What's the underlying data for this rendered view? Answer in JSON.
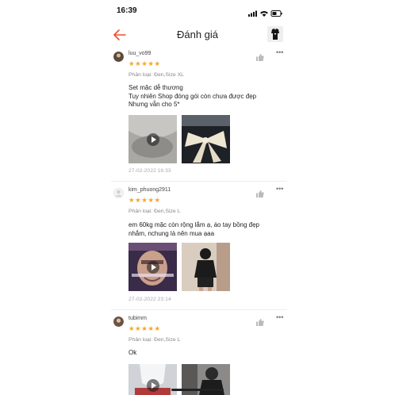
{
  "status_bar": {
    "time": "16:39"
  },
  "header": {
    "title": "Đánh giá"
  },
  "reviews": [
    {
      "username": "luu_vo99",
      "stars": "★★★★★",
      "variant": "Phân loại: Đen,Size XL",
      "text": [
        "Set mặc dễ thương",
        "Tuy nhiên Shop đóng gói còn chưa được đẹp",
        "Nhưng vẫn cho 5*"
      ],
      "date": "27-02-2022 16:33"
    },
    {
      "username": "kim_phuong2911",
      "stars": "★★★★★",
      "variant": "Phân loại: Đen,Size L",
      "text": [
        "em 60kg mặc còn rộng lắm ạ, áo tay bồng đẹp",
        "nhắm, nchung là nên mua ạaa"
      ],
      "date": "27-02-2022 23:14"
    },
    {
      "username": "tubimm",
      "stars": "★★★★★",
      "variant": "Phân loại: Đen,Size L",
      "text": [
        "Ok"
      ],
      "date": ""
    }
  ],
  "icons": {
    "back": "arrow-left-icon",
    "like": "thumbs-up-icon",
    "more": "more-icon",
    "play": "play-icon"
  },
  "colors": {
    "accent": "#ee4d2d",
    "stars": "#f5a623"
  }
}
